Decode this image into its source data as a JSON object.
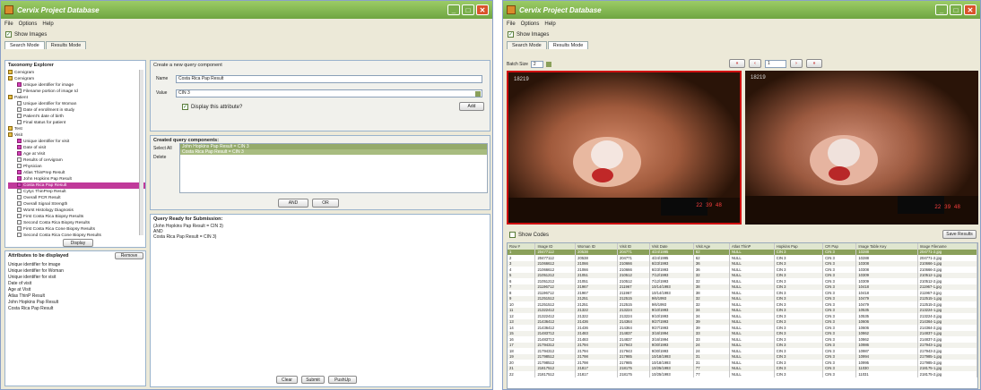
{
  "left": {
    "title": "Cervix Project Database",
    "menu": [
      "File",
      "Options",
      "Help"
    ],
    "show_images": "Show Images",
    "tabs": [
      "Search Mode",
      "Results Mode"
    ],
    "taxonomy_title": "Taxonomy Explorer",
    "tree": [
      {
        "label": "Cervigram",
        "icon": "folder"
      },
      {
        "label": "Cervigram",
        "icon": "folder"
      },
      {
        "label": "Unique identifier for image",
        "icon": "attr-pink"
      },
      {
        "label": "Filename portion of image Id",
        "icon": "attr"
      },
      {
        "label": "Patient",
        "icon": "folder"
      },
      {
        "label": "Unique identifier for Woman",
        "icon": "attr"
      },
      {
        "label": "Date of enrollment in study",
        "icon": "attr"
      },
      {
        "label": "Patient's date of birth",
        "icon": "attr"
      },
      {
        "label": "Final status for patient",
        "icon": "attr"
      },
      {
        "label": "Test",
        "icon": "folder"
      },
      {
        "label": "Visit",
        "icon": "folder"
      },
      {
        "label": "Unique identifier for visit",
        "icon": "attr-pink"
      },
      {
        "label": "Date of visit",
        "icon": "attr-pink"
      },
      {
        "label": "Age at Visit",
        "icon": "attr-pink"
      },
      {
        "label": "Results of cervigram",
        "icon": "attr"
      },
      {
        "label": "Physician",
        "icon": "attr"
      },
      {
        "label": "Atlas ThinPrep Result",
        "icon": "attr-pink"
      },
      {
        "label": "John Hopkins Pap Result",
        "icon": "attr-pink"
      },
      {
        "label": "Costa Rica Pap Result",
        "icon": "attr-pink",
        "selected": true
      },
      {
        "label": "Cytyc ThinPrep Result",
        "icon": "attr"
      },
      {
        "label": "Overall PCR Result",
        "icon": "attr"
      },
      {
        "label": "Overall Signal Strength",
        "icon": "attr"
      },
      {
        "label": "Worst Histology Diagnosis",
        "icon": "attr"
      },
      {
        "label": "First Costa Rica Biopsy Results",
        "icon": "attr"
      },
      {
        "label": "Second Costa Rica Biopsy Results",
        "icon": "attr"
      },
      {
        "label": "First Costa Rica Cone Biopsy Results",
        "icon": "attr"
      },
      {
        "label": "Second Costa Rica Cone Biopsy Results",
        "icon": "attr"
      }
    ],
    "display_btn": "Display",
    "attrs_title": "Attributes to be displayed",
    "remove_btn": "Remove",
    "attrs": [
      "Unique identifier for image",
      "Unique identifier for Woman",
      "Unique identifier for visit",
      "Date of visit",
      "Age at Visit",
      "Atlas ThinP Result",
      "John Hopkins Pap Result",
      "Costa Rica Pap Result"
    ],
    "create_title": "Create a new query component",
    "name_label": "Name",
    "name_value": "Costa Rica Pap Result",
    "value_label": "Value",
    "value_value": "CIN 3",
    "display_attr": "Display this attribute?",
    "add_btn": "Add",
    "created_title": "Created query components:",
    "select_all": "Select All",
    "delete": "Delete",
    "components": [
      "John Hopkins Pap Result = CIN 3",
      "Costa Rica Pap Result = CIN 3"
    ],
    "and_btn": "AND",
    "or_btn": "OR",
    "query_title": "Query Ready for Submission:",
    "query_lines": [
      "(John Hopkins Pap Result = CIN 3)",
      "AND",
      "Costa Rica Pap Result = CIN 3)"
    ],
    "clear_btn": "Clear",
    "submit_btn": "Submit",
    "pushup_btn": "PushUp"
  },
  "right": {
    "title": "Cervix Project Database",
    "menu": [
      "File",
      "Options",
      "Help"
    ],
    "show_images": "Show Images",
    "tabs": [
      "Search Mode",
      "Results Mode"
    ],
    "batch_label": "Batch Size",
    "batch_value": "2",
    "page_value": "1",
    "images": [
      {
        "stamp": "18219",
        "ts": "22 39 48"
      },
      {
        "stamp": "18219",
        "ts": "22 39 48"
      }
    ],
    "show_codes": "Show Codes",
    "save_results": "Save Results",
    "columns": [
      "Row #",
      "Image ID",
      "Woman ID",
      "Visit ID",
      "Visit Date",
      "Visit Age",
      "Atlas ThinP",
      "Hopkins Pap",
      "CR Pap",
      "Image Table Key",
      "Image Filename"
    ],
    "rows": [
      [
        "1",
        "20477112",
        "20538",
        "204771",
        "4/24/1995",
        "62",
        "NULL",
        "CIN 3",
        "CIN 3",
        "10288",
        "204771-2.jpg"
      ],
      [
        "2",
        "20477112",
        "20538",
        "204771",
        "4/24/1995",
        "62",
        "NULL",
        "CIN 3",
        "CIN 3",
        "10288",
        "204771-2.jpg"
      ],
      [
        "3",
        "21066612",
        "21066",
        "210666",
        "6/23/1993",
        "36",
        "NULL",
        "CIN 3",
        "CIN 3",
        "10308",
        "210666-1.jpg"
      ],
      [
        "4",
        "21066612",
        "21066",
        "210666",
        "6/23/1993",
        "36",
        "NULL",
        "CIN 3",
        "CIN 3",
        "10308",
        "210666-2.jpg"
      ],
      [
        "5",
        "21051212",
        "21051",
        "210512",
        "7/12/1993",
        "32",
        "NULL",
        "CIN 3",
        "CIN 3",
        "10309",
        "210512-1.jpg"
      ],
      [
        "6",
        "21051212",
        "21051",
        "210512",
        "7/12/1993",
        "32",
        "NULL",
        "CIN 3",
        "CIN 3",
        "10309",
        "210512-2.jpg"
      ],
      [
        "7",
        "21196712",
        "21967",
        "211967",
        "10/14/1993",
        "38",
        "NULL",
        "CIN 3",
        "CIN 3",
        "10418",
        "211967-1.jpg"
      ],
      [
        "8",
        "21196712",
        "21967",
        "211967",
        "10/14/1993",
        "38",
        "NULL",
        "CIN 3",
        "CIN 3",
        "10418",
        "211967-2.jpg"
      ],
      [
        "9",
        "21251512",
        "21251",
        "212515",
        "9/6/1993",
        "32",
        "NULL",
        "CIN 3",
        "CIN 3",
        "10479",
        "212515-1.jpg"
      ],
      [
        "10",
        "21251512",
        "21251",
        "212515",
        "9/6/1993",
        "32",
        "NULL",
        "CIN 3",
        "CIN 3",
        "10479",
        "212515-2.jpg"
      ],
      [
        "11",
        "21322412",
        "21322",
        "213224",
        "9/10/1993",
        "34",
        "NULL",
        "CIN 3",
        "CIN 3",
        "10535",
        "213224-1.jpg"
      ],
      [
        "12",
        "21322412",
        "21322",
        "213224",
        "9/10/1993",
        "34",
        "NULL",
        "CIN 3",
        "CIN 3",
        "10535",
        "213224-2.jpg"
      ],
      [
        "13",
        "21436412",
        "21436",
        "214364",
        "9/27/1993",
        "39",
        "NULL",
        "CIN 3",
        "CIN 3",
        "10606",
        "214364-1.jpg"
      ],
      [
        "14",
        "21436412",
        "21436",
        "214364",
        "9/27/1993",
        "39",
        "NULL",
        "CIN 3",
        "CIN 3",
        "10606",
        "214364-2.jpg"
      ],
      [
        "15",
        "21483712",
        "21483",
        "214837",
        "3/16/1994",
        "33",
        "NULL",
        "CIN 3",
        "CIN 3",
        "10862",
        "214837-1.jpg"
      ],
      [
        "16",
        "21483712",
        "21483",
        "214837",
        "3/16/1994",
        "33",
        "NULL",
        "CIN 3",
        "CIN 3",
        "10862",
        "214837-2.jpg"
      ],
      [
        "17",
        "21794312",
        "21794",
        "217943",
        "9/30/1993",
        "24",
        "NULL",
        "CIN 3",
        "CIN 3",
        "10986",
        "217943-1.jpg"
      ],
      [
        "18",
        "21794312",
        "21794",
        "217943",
        "9/30/1993",
        "24",
        "NULL",
        "CIN 3",
        "CIN 3",
        "10987",
        "217943-2.jpg"
      ],
      [
        "19",
        "21798512",
        "21798",
        "217985",
        "10/18/1993",
        "31",
        "NULL",
        "CIN 3",
        "CIN 3",
        "10994",
        "217985-1.jpg"
      ],
      [
        "20",
        "21798512",
        "21798",
        "217985",
        "10/18/1993",
        "31",
        "NULL",
        "CIN 3",
        "CIN 3",
        "10995",
        "217985-2.jpg"
      ],
      [
        "21",
        "21817512",
        "21817",
        "218175",
        "10/25/1993",
        "77",
        "NULL",
        "CIN 3",
        "CIN 3",
        "11030",
        "218175-1.jpg"
      ],
      [
        "22",
        "21817512",
        "21817",
        "218175",
        "10/25/1993",
        "77",
        "NULL",
        "CIN 3",
        "CIN 3",
        "11031",
        "218175-2.jpg"
      ]
    ]
  }
}
